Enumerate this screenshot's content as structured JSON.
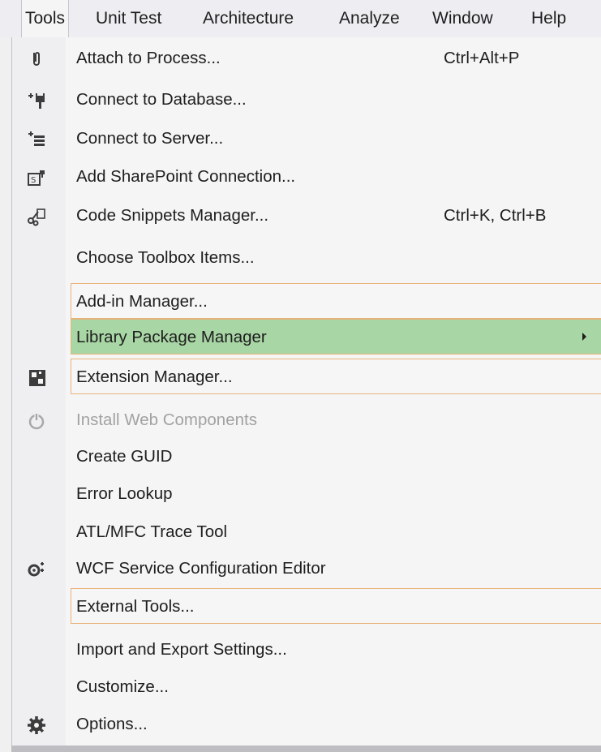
{
  "menubar": {
    "items": [
      "Tools",
      "Unit Test",
      "Architecture",
      "Analyze",
      "Window",
      "Help"
    ]
  },
  "menu": {
    "items": [
      {
        "label": "Attach to Process...",
        "shortcut": "Ctrl+Alt+P",
        "icon": "paperclip-icon"
      },
      {
        "label": "Connect to Database...",
        "shortcut": "",
        "icon": "add-database-icon"
      },
      {
        "label": "Connect to Server...",
        "shortcut": "",
        "icon": "add-server-icon"
      },
      {
        "label": "Add SharePoint Connection...",
        "shortcut": "",
        "icon": "sharepoint-connection-icon"
      },
      {
        "label": "Code Snippets Manager...",
        "shortcut": "Ctrl+K, Ctrl+B",
        "icon": "code-snippets-icon"
      },
      {
        "label": "Choose Toolbox Items...",
        "shortcut": "",
        "icon": ""
      },
      {
        "label": "Add-in Manager...",
        "shortcut": "",
        "icon": ""
      },
      {
        "label": "Library Package Manager",
        "shortcut": "",
        "icon": "",
        "submenu": true
      },
      {
        "label": "Extension Manager...",
        "shortcut": "",
        "icon": "extension-manager-icon"
      },
      {
        "label": "Install Web Components",
        "shortcut": "",
        "icon": "power-icon",
        "disabled": true
      },
      {
        "label": "Create GUID",
        "shortcut": "",
        "icon": ""
      },
      {
        "label": "Error Lookup",
        "shortcut": "",
        "icon": ""
      },
      {
        "label": "ATL/MFC Trace Tool",
        "shortcut": "",
        "icon": ""
      },
      {
        "label": "WCF Service Configuration Editor",
        "shortcut": "",
        "icon": "wcf-config-icon"
      },
      {
        "label": "External Tools...",
        "shortcut": "",
        "icon": ""
      },
      {
        "label": "Import and Export Settings...",
        "shortcut": "",
        "icon": ""
      },
      {
        "label": "Customize...",
        "shortcut": "",
        "icon": ""
      },
      {
        "label": "Options...",
        "shortcut": "",
        "icon": "gear-icon"
      }
    ]
  },
  "colors": {
    "highlight": "#a8d6a4",
    "callout_border": "#e8b37a",
    "disabled_text": "#a2a2a2"
  }
}
